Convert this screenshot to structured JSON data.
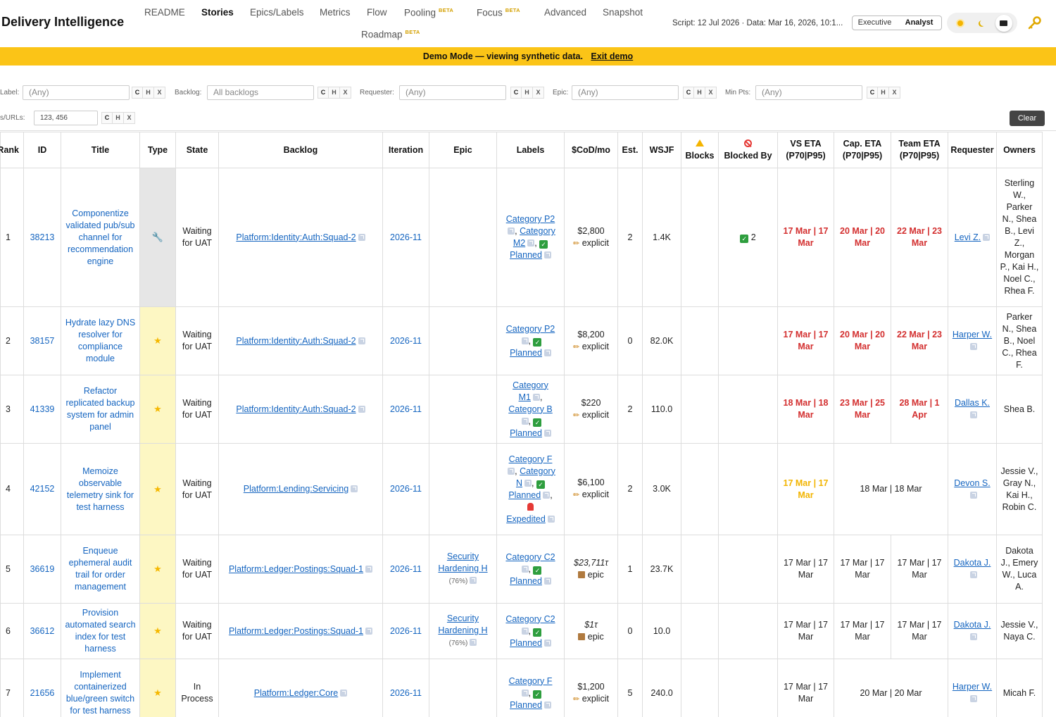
{
  "header": {
    "title": "Delivery Intelligence",
    "nav": [
      "README",
      "Stories",
      "Epics/Labels",
      "Metrics",
      "Flow",
      "Pooling",
      "Focus",
      "Advanced",
      "Snapshot",
      "Roadmap"
    ],
    "beta_label": "BETA",
    "meta": "Script: 12 Jul 2026 · Data: Mar 16, 2026, 10:1...",
    "modes": [
      "Executive",
      "Analyst"
    ]
  },
  "banner": {
    "text": "Demo Mode — viewing synthetic data.",
    "link": "Exit demo"
  },
  "filters": {
    "label": {
      "label": "Label:",
      "value": "(Any)"
    },
    "backlog": {
      "label": "Backlog:",
      "value": "All backlogs"
    },
    "requester": {
      "label": "Requester:",
      "value": "(Any)"
    },
    "epic": {
      "label": "Epic:",
      "value": "(Any)"
    },
    "min_pts": {
      "label": "Min Pts:",
      "value": "(Any)"
    },
    "ids": {
      "label": "IDs/URLs:",
      "value": "123, 456"
    },
    "btn_c": "C",
    "btn_h": "H",
    "btn_x": "X",
    "clear": "Clear"
  },
  "table": {
    "headers": {
      "rank": "Rank",
      "id": "ID",
      "title": "Title",
      "type": "Type",
      "state": "State",
      "backlog": "Backlog",
      "iteration": "Iteration",
      "epic": "Epic",
      "labels": "Labels",
      "cod": "$CoD/mo",
      "est": "Est.",
      "wsjf": "WSJF",
      "blocks": "Blocks",
      "blocked_by": "Blocked By",
      "vs_eta": "VS ETA",
      "cap_eta": "Cap. ETA",
      "team_eta": "Team ETA",
      "eta_sub": "(P70|P95)",
      "requester": "Requester",
      "owners": "Owners"
    },
    "rows": [
      {
        "rank": "1",
        "id": "38213",
        "title": "Componentize validated pub/sub channel for recommendation engine",
        "type_icon": "wrench-icon",
        "state": "Waiting for UAT",
        "backlog": "Platform:Identity:Auth:Squad-2",
        "iteration": "2026-11",
        "epic": "",
        "epic_pct": "",
        "labels": [
          "Category P2",
          "Category M2",
          "Planned"
        ],
        "cod": "$2,800",
        "cod_src": "explicit",
        "cod_italic": false,
        "est": "2",
        "wsjf": "1.4K",
        "blocked_by": "2",
        "vs_eta": "17 Mar | 17 Mar",
        "cap_eta": "20 Mar | 20 Mar",
        "team_eta": "22 Mar | 23 Mar",
        "eta_color": "red",
        "requester": "Levi Z.",
        "owners": "Sterling W., Parker N., Shea B., Levi Z., Morgan P., Kai H., Noel C., Rhea F."
      },
      {
        "rank": "2",
        "id": "38157",
        "title": "Hydrate lazy DNS resolver for compliance module",
        "type_icon": "star-icon",
        "state": "Waiting for UAT",
        "backlog": "Platform:Identity:Auth:Squad-2",
        "iteration": "2026-11",
        "epic": "",
        "epic_pct": "",
        "labels": [
          "Category P2",
          "Planned"
        ],
        "cod": "$8,200",
        "cod_src": "explicit",
        "cod_italic": false,
        "est": "0",
        "wsjf": "82.0K",
        "blocked_by": "",
        "vs_eta": "17 Mar | 17 Mar",
        "cap_eta": "20 Mar | 20 Mar",
        "team_eta": "22 Mar | 23 Mar",
        "eta_color": "red",
        "requester": "Harper W.",
        "owners": "Parker N., Shea B., Noel C., Rhea F."
      },
      {
        "rank": "3",
        "id": "41339",
        "title": "Refactor replicated backup system for admin panel",
        "type_icon": "star-icon",
        "state": "Waiting for UAT",
        "backlog": "Platform:Identity:Auth:Squad-2",
        "iteration": "2026-11",
        "epic": "",
        "epic_pct": "",
        "labels": [
          "Category M1",
          "Category B",
          "Planned"
        ],
        "cod": "$220",
        "cod_src": "explicit",
        "cod_italic": false,
        "est": "2",
        "wsjf": "110.0",
        "blocked_by": "",
        "vs_eta": "18 Mar | 18 Mar",
        "cap_eta": "23 Mar | 25 Mar",
        "team_eta": "28 Mar | 1 Apr",
        "eta_color": "red",
        "requester": "Dallas K.",
        "owners": "Shea B."
      },
      {
        "rank": "4",
        "id": "42152",
        "title": "Memoize observable telemetry sink for test harness",
        "type_icon": "star-icon",
        "state": "Waiting for UAT",
        "backlog": "Platform:Lending:Servicing",
        "iteration": "2026-11",
        "epic": "",
        "epic_pct": "",
        "labels": [
          "Category F",
          "Category N",
          "Planned",
          "Expedited"
        ],
        "cod": "$6,100",
        "cod_src": "explicit",
        "cod_italic": false,
        "est": "2",
        "wsjf": "3.0K",
        "blocked_by": "",
        "vs_eta": "17 Mar | 17 Mar",
        "cap_eta": "18 Mar | 18 Mar",
        "team_eta": "",
        "eta_color": "amber",
        "requester": "Devon S.",
        "owners": "Jessie V., Gray N., Kai H., Robin C."
      },
      {
        "rank": "5",
        "id": "36619",
        "title": "Enqueue ephemeral audit trail for order management",
        "type_icon": "star-icon",
        "state": "Waiting for UAT",
        "backlog": "Platform:Ledger:Postings:Squad-1",
        "iteration": "2026-11",
        "epic": "Security Hardening H",
        "epic_pct": "(76%)",
        "labels": [
          "Category C2",
          "Planned"
        ],
        "cod": "$23,711τ",
        "cod_src": "epic",
        "cod_italic": true,
        "est": "1",
        "wsjf": "23.7K",
        "blocked_by": "",
        "vs_eta": "17 Mar | 17 Mar",
        "cap_eta": "17 Mar | 17 Mar",
        "team_eta": "17 Mar | 17 Mar",
        "eta_color": "",
        "requester": "Dakota J.",
        "owners": "Dakota J., Emery W., Luca A."
      },
      {
        "rank": "6",
        "id": "36612",
        "title": "Provision automated search index for test harness",
        "type_icon": "star-icon",
        "state": "Waiting for UAT",
        "backlog": "Platform:Ledger:Postings:Squad-1",
        "iteration": "2026-11",
        "epic": "Security Hardening H",
        "epic_pct": "(76%)",
        "labels": [
          "Category C2",
          "Planned"
        ],
        "cod": "$1τ",
        "cod_src": "epic",
        "cod_italic": true,
        "est": "0",
        "wsjf": "10.0",
        "blocked_by": "",
        "vs_eta": "17 Mar | 17 Mar",
        "cap_eta": "17 Mar | 17 Mar",
        "team_eta": "17 Mar | 17 Mar",
        "eta_color": "",
        "requester": "Dakota J.",
        "owners": "Jessie V., Naya C."
      },
      {
        "rank": "7",
        "id": "21656",
        "title": "Implement containerized blue/green switch for test harness",
        "type_icon": "star-icon",
        "state": "In Process",
        "backlog": "Platform:Ledger:Core",
        "iteration": "2026-11",
        "epic": "",
        "epic_pct": "",
        "labels": [
          "Category F",
          "Planned"
        ],
        "cod": "$1,200",
        "cod_src": "explicit",
        "cod_italic": false,
        "est": "5",
        "wsjf": "240.0",
        "blocked_by": "",
        "vs_eta": "17 Mar | 17 Mar",
        "cap_eta": "20 Mar | 20 Mar",
        "team_eta": "",
        "eta_color": "",
        "requester": "Harper W.",
        "owners": "Micah F."
      }
    ]
  },
  "colors": {
    "banner": "#fbc417",
    "link": "#1565c0",
    "eta_red": "#d32f2f",
    "eta_amber": "#f2b400",
    "type_yellow": "#fdf7c3"
  }
}
